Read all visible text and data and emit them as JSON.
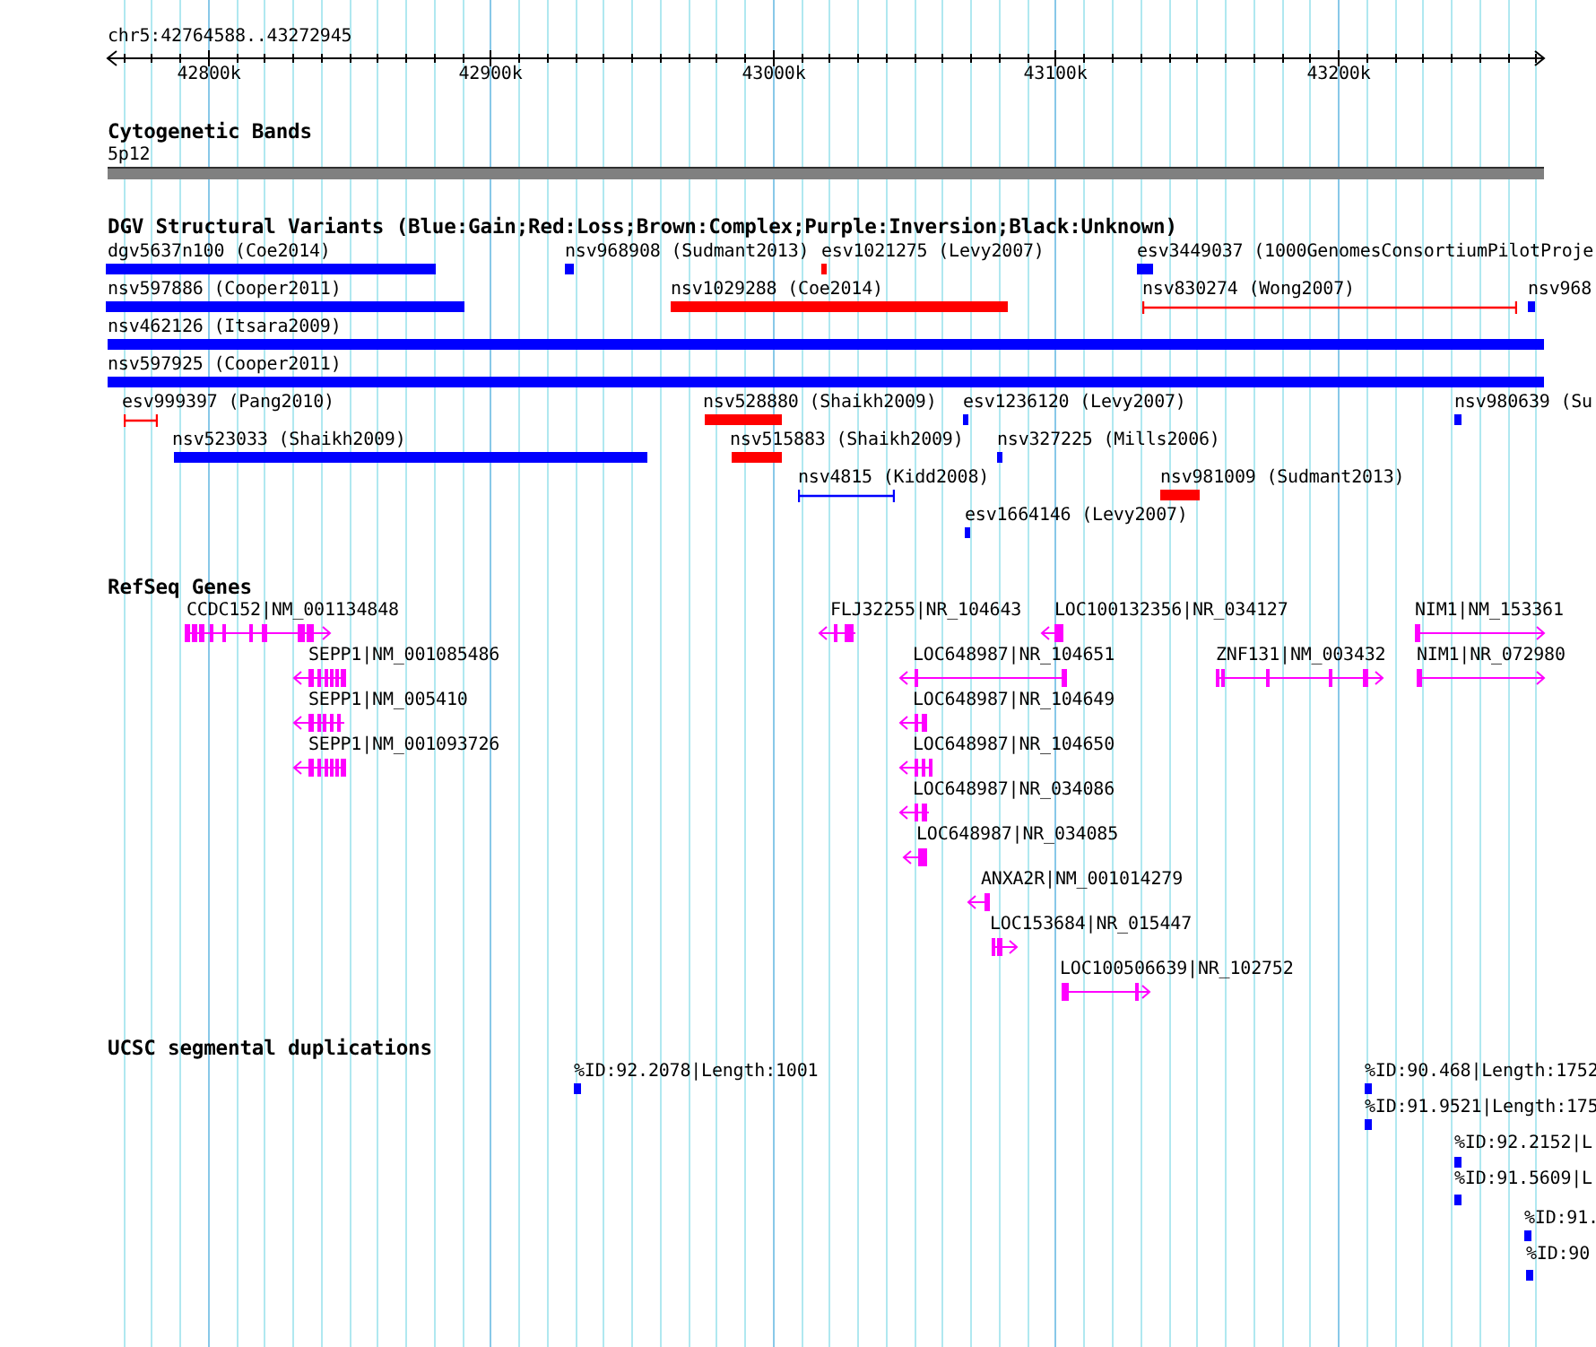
{
  "ruler": {
    "region": "chr5:42764588..43272945",
    "ticks": [
      "42800k",
      "42900k",
      "43000k",
      "43100k",
      "43200k"
    ]
  },
  "cytogenetic_bands": {
    "title": "Cytogenetic Bands",
    "bands": [
      {
        "label": "5p12",
        "kind": "band"
      }
    ]
  },
  "dgv_variants": {
    "title": "DGV Structural Variants (Blue:Gain;Red:Loss;Brown:Complex;Purple:Inversion;Black:Unknown)",
    "features": [
      {
        "label": "dgv5637n100 (Coe2014)",
        "kind": "bar",
        "color": "#0000ff"
      },
      {
        "label": "nsv968908 (Sudmant2013)",
        "kind": "bar",
        "color": "#0000ff"
      },
      {
        "label": "esv1021275 (Levy2007)",
        "kind": "bar",
        "color": "#ff0000"
      },
      {
        "label": "esv3449037 (1000GenomesConsortiumPilotProje",
        "kind": "bar",
        "color": "#0000ff"
      },
      {
        "label": "nsv597886 (Cooper2011)",
        "kind": "bar",
        "color": "#0000ff"
      },
      {
        "label": "nsv1029288 (Coe2014)",
        "kind": "bar",
        "color": "#ff0000"
      },
      {
        "label": "nsv830274 (Wong2007)",
        "kind": "span",
        "color": "#ff0000"
      },
      {
        "label": "nsv968",
        "kind": "bar",
        "color": "#0000ff"
      },
      {
        "label": "nsv462126 (Itsara2009)",
        "kind": "bar",
        "color": "#0000ff"
      },
      {
        "label": "nsv597925 (Cooper2011)",
        "kind": "bar",
        "color": "#0000ff"
      },
      {
        "label": "esv999397 (Pang2010)",
        "kind": "span",
        "color": "#ff0000"
      },
      {
        "label": "nsv528880 (Shaikh2009)",
        "kind": "bar",
        "color": "#ff0000"
      },
      {
        "label": "esv1236120 (Levy2007)",
        "kind": "bar",
        "color": "#0000ff"
      },
      {
        "label": "nsv980639 (Su",
        "kind": "bar",
        "color": "#0000ff"
      },
      {
        "label": "nsv523033 (Shaikh2009)",
        "kind": "bar",
        "color": "#0000ff"
      },
      {
        "label": "nsv515883 (Shaikh2009)",
        "kind": "bar",
        "color": "#ff0000"
      },
      {
        "label": "nsv327225 (Mills2006)",
        "kind": "bar",
        "color": "#0000ff"
      },
      {
        "label": "nsv4815 (Kidd2008)",
        "kind": "span",
        "color": "#0000ff"
      },
      {
        "label": "nsv981009 (Sudmant2013)",
        "kind": "bar",
        "color": "#ff0000"
      },
      {
        "label": "esv1664146 (Levy2007)",
        "kind": "bar",
        "color": "#0000ff"
      }
    ]
  },
  "refseq_genes": {
    "title": "RefSeq Genes",
    "genes": [
      {
        "label": "CCDC152|NM_001134848",
        "forward": true
      },
      {
        "label": "FLJ32255|NR_104643",
        "forward": false
      },
      {
        "label": "LOC100132356|NR_034127",
        "forward": false
      },
      {
        "label": "NIM1|NM_153361",
        "forward": true
      },
      {
        "label": "SEPP1|NM_001085486",
        "forward": false
      },
      {
        "label": "LOC648987|NR_104651",
        "forward": false
      },
      {
        "label": "ZNF131|NM_003432",
        "forward": true
      },
      {
        "label": "NIM1|NR_072980",
        "forward": true
      },
      {
        "label": "SEPP1|NM_005410",
        "forward": false
      },
      {
        "label": "LOC648987|NR_104649",
        "forward": false
      },
      {
        "label": "SEPP1|NM_001093726",
        "forward": false
      },
      {
        "label": "LOC648987|NR_104650",
        "forward": false
      },
      {
        "label": "LOC648987|NR_034086",
        "forward": false
      },
      {
        "label": "LOC648987|NR_034085",
        "forward": false
      },
      {
        "label": "ANXA2R|NM_001014279",
        "forward": false
      },
      {
        "label": "LOC153684|NR_015447",
        "forward": true
      },
      {
        "label": "LOC100506639|NR_102752",
        "forward": true
      }
    ]
  },
  "segmental_duplications": {
    "title": "UCSC segmental duplications",
    "features": [
      {
        "label": "%ID:92.2078|Length:1001"
      },
      {
        "label": "%ID:90.468|Length:1752"
      },
      {
        "label": "%ID:91.9521|Length:175"
      },
      {
        "label": "%ID:92.2152|L"
      },
      {
        "label": "%ID:91.5609|L"
      },
      {
        "label": "%ID:91."
      },
      {
        "label": "%ID:90"
      }
    ]
  }
}
